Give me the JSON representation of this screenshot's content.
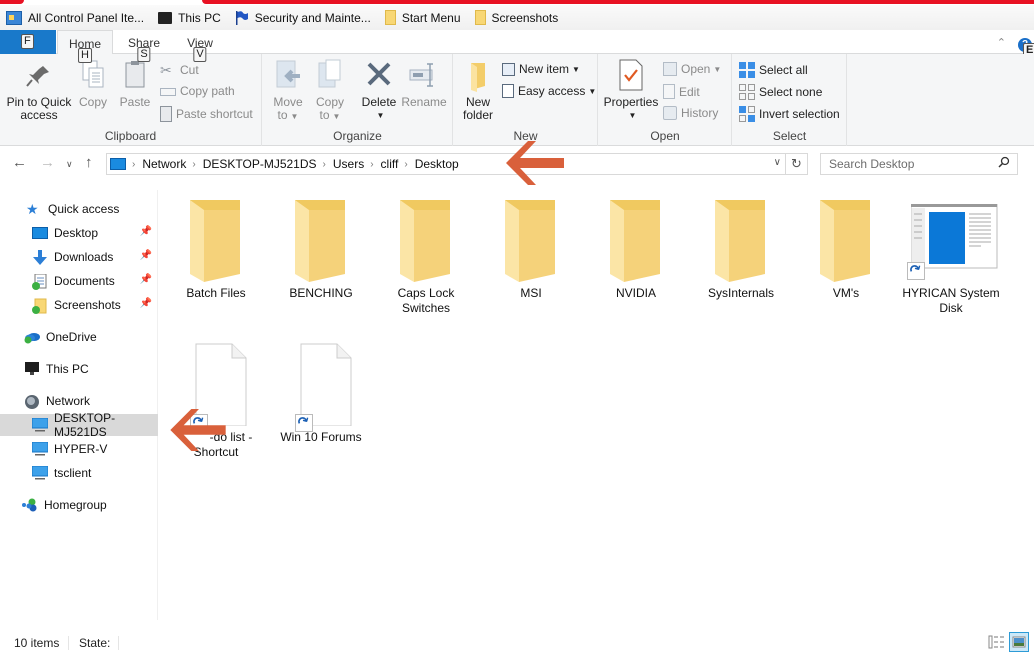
{
  "favorites": [
    {
      "label": "All Control Panel Ite...",
      "icon": "control-panel-icon"
    },
    {
      "label": "This PC",
      "icon": "this-pc-icon"
    },
    {
      "label": "Security and Mainte...",
      "icon": "flag-icon"
    },
    {
      "label": "Start Menu",
      "icon": "folder-icon"
    },
    {
      "label": "Screenshots",
      "icon": "folder-icon"
    }
  ],
  "ribbon": {
    "file_keytip": "F",
    "tabs": [
      {
        "label": "Home",
        "keytip": "H",
        "active": true
      },
      {
        "label": "Share",
        "keytip": "S"
      },
      {
        "label": "View",
        "keytip": "V"
      }
    ],
    "help_keytip": "E",
    "clipboard": {
      "label": "Clipboard",
      "pin_line1": "Pin to Quick",
      "pin_line2": "access",
      "copy": "Copy",
      "paste": "Paste",
      "cut": "Cut",
      "copy_path": "Copy path",
      "paste_shortcut": "Paste shortcut"
    },
    "organize": {
      "label": "Organize",
      "move_to_1": "Move",
      "move_to_2": "to",
      "copy_to_1": "Copy",
      "copy_to_2": "to",
      "delete": "Delete",
      "rename": "Rename"
    },
    "new": {
      "label": "New",
      "new_folder_1": "New",
      "new_folder_2": "folder",
      "new_item": "New item",
      "easy_access": "Easy access"
    },
    "open": {
      "label": "Open",
      "properties": "Properties",
      "open": "Open",
      "edit": "Edit",
      "history": "History"
    },
    "select": {
      "label": "Select",
      "select_all": "Select all",
      "select_none": "Select none",
      "invert_selection": "Invert selection"
    }
  },
  "address": {
    "crumbs": [
      "Network",
      "DESKTOP-MJ521DS",
      "Users",
      "cliff",
      "Desktop"
    ],
    "search_placeholder": "Search Desktop"
  },
  "sidebar": {
    "quick_access": "Quick access",
    "quick_items": [
      {
        "label": "Desktop",
        "pinned": true
      },
      {
        "label": "Downloads",
        "pinned": true
      },
      {
        "label": "Documents",
        "pinned": true
      },
      {
        "label": "Screenshots",
        "pinned": true
      }
    ],
    "onedrive": "OneDrive",
    "this_pc": "This PC",
    "network": "Network",
    "network_items": [
      {
        "label": "DESKTOP-MJ521DS",
        "selected": true
      },
      {
        "label": "HYPER-V"
      },
      {
        "label": "tsclient"
      }
    ],
    "homegroup": "Homegroup"
  },
  "items": [
    {
      "label": "Batch Files",
      "type": "folder"
    },
    {
      "label": "BENCHING",
      "type": "folder"
    },
    {
      "label": "Caps Lock Switches",
      "type": "folder"
    },
    {
      "label": "MSI",
      "type": "folder"
    },
    {
      "label": "NVIDIA",
      "type": "folder"
    },
    {
      "label": "SysInternals",
      "type": "folder"
    },
    {
      "label": "VM's",
      "type": "folder"
    },
    {
      "label": "HYRICAN System Disk",
      "type": "shortcut-app"
    },
    {
      "label": "To-do list - Shortcut",
      "visible_label": "-do list - Shortcut",
      "type": "shortcut-file"
    },
    {
      "label": "Win 10 Forums",
      "type": "shortcut-file"
    }
  ],
  "status": {
    "item_count": "10 items",
    "state_label": "State:"
  },
  "colors": {
    "accent": "#1979ca",
    "annotation_arrow": "#d9603b",
    "titlebar_red": "#e81123",
    "folder": "#f8d775"
  }
}
